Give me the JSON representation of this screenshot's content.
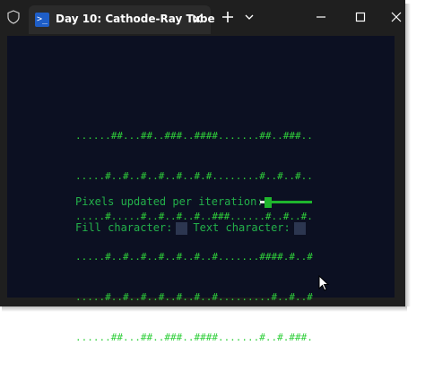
{
  "tab": {
    "title": "Day 10: Cathode-Ray Tube",
    "icon": "terminal-icon",
    "icon_glyph": ">_"
  },
  "toolbar": {
    "new_tab_icon": "plus-icon",
    "dropdown_icon": "chevron-down-icon"
  },
  "window_controls": {
    "minimize_icon": "minimize-icon",
    "maximize_icon": "maximize-icon",
    "close_icon": "close-icon"
  },
  "display": {
    "lines": [
      "......##...##..###..####.......##..###..",
      ".....#..#..#..#..#..#.#........#..#..#..",
      ".....#.....#..#..#..#..###......#..#..#.",
      ".....#..#..#..#..#..#..#.......####.#..#",
      ".....#..#..#..#..#..#..#.........#..#..#",
      "......##...##..###..####.......#..#.###."
    ],
    "colors": {
      "text": "#2fcf3a",
      "background": "#0c1022"
    }
  },
  "controls": {
    "pixels_label": "Pixels updated per iteration:",
    "slider_value_fraction": 0.1,
    "fill_label": "Fill character:",
    "text_label": "Text character:"
  }
}
